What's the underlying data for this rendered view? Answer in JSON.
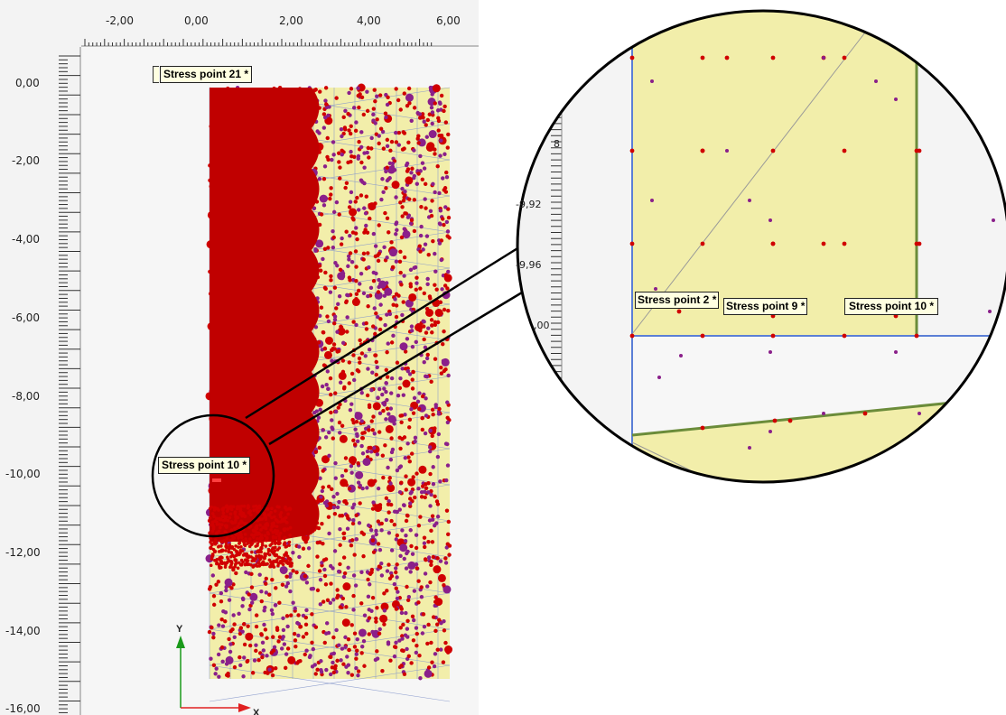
{
  "view": {
    "x_ticks": [
      "-2,00",
      "0,00",
      "2,00",
      "4,00",
      "6,00"
    ],
    "y_ticks": [
      "0,00",
      "-2,00",
      "-4,00",
      "-6,00",
      "-8,00",
      "-10,00",
      "-12,00",
      "-14,00",
      "-16,00"
    ],
    "stress_labels": {
      "top": "Stress point 21 *",
      "middle": "Stress point 10 *"
    },
    "axis": {
      "x_label": "X",
      "y_label": "Y"
    }
  },
  "zoom": {
    "y_ticks": [
      "8",
      "-9,92",
      "-9,96",
      ",00"
    ],
    "stress_labels": [
      "Stress point 2 *",
      "Stress point 9 *",
      "Stress point 10 *"
    ]
  },
  "colors": {
    "soil_fill": "#f2eeaa",
    "red_region": "#c00000",
    "stress_point": "#d00000",
    "node_point": "#8a1f8a",
    "mesh_line": "#8899cc",
    "interface_line": "#6b8c3a",
    "boundary_line": "#5b7fd6",
    "tag_bg": "#ffffe1"
  }
}
